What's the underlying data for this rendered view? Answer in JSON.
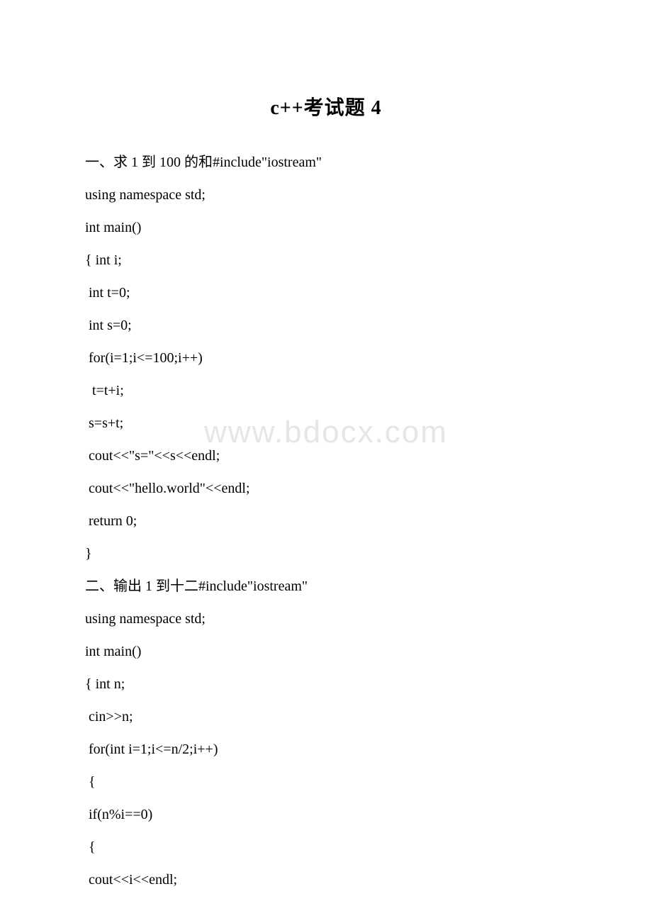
{
  "title": "c++考试题 4",
  "watermark": "www.bdocx.com",
  "lines": [
    "一、求 1 到 100 的和#include\"iostream\"",
    "using namespace std;",
    "int main()",
    "{ int i;",
    " int t=0;",
    " int s=0;",
    " for(i=1;i<=100;i++)",
    "  t=t+i;",
    " s=s+t;",
    " cout<<\"s=\"<<s<<endl;",
    " cout<<\"hello.world\"<<endl;",
    " return 0;",
    "}",
    "二、输出 1 到十二#include\"iostream\"",
    "using namespace std;",
    "int main()",
    "{ int n;",
    " cin>>n;",
    " for(int i=1;i<=n/2;i++)",
    " {",
    " if(n%i==0)",
    "",
    " {",
    " cout<<i<<endl;"
  ]
}
